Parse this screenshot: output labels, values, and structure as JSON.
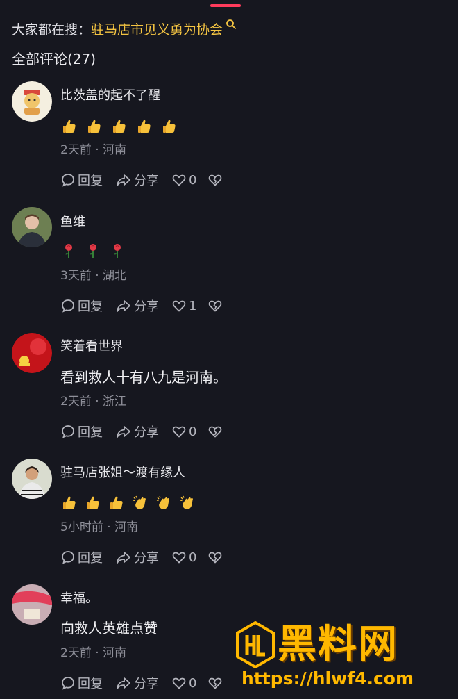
{
  "search_hint": {
    "label": "大家都在搜：",
    "term": "驻马店市见义勇为协会"
  },
  "comments_header": "全部评论(27)",
  "actions_labels": {
    "reply": "回复",
    "share": "分享"
  },
  "comments": [
    {
      "username": "比茨盖的起不了醒",
      "content_type": "emoji",
      "emojis": [
        "thumbs-up",
        "thumbs-up",
        "thumbs-up",
        "thumbs-up",
        "thumbs-up"
      ],
      "meta": "2天前 · 河南",
      "likes": "0"
    },
    {
      "username": "鱼维",
      "content_type": "emoji",
      "emojis": [
        "rose",
        "rose",
        "rose"
      ],
      "meta": "3天前 · 湖北",
      "likes": "1"
    },
    {
      "username": "笑着看世界",
      "content_type": "text",
      "text": "看到救人十有八九是河南。",
      "meta": "2天前 · 浙江",
      "likes": "0"
    },
    {
      "username": "驻马店张姐～渡有缘人",
      "content_type": "emoji",
      "emojis": [
        "thumbs-up",
        "thumbs-up",
        "thumbs-up",
        "clap",
        "clap",
        "clap"
      ],
      "meta": "5小时前 · 河南",
      "likes": "0"
    },
    {
      "username": "幸福。",
      "content_type": "text",
      "text": "向救人英雄点赞",
      "meta": "2天前 · 河南",
      "likes": "0"
    }
  ],
  "watermark": {
    "brand": "黑料网",
    "url": "https://hlwf4.com"
  },
  "colors": {
    "background": "#16171f",
    "search_term": "#f5c542",
    "tab_indicator": "#ff3b5c",
    "watermark": "#ffb800"
  }
}
